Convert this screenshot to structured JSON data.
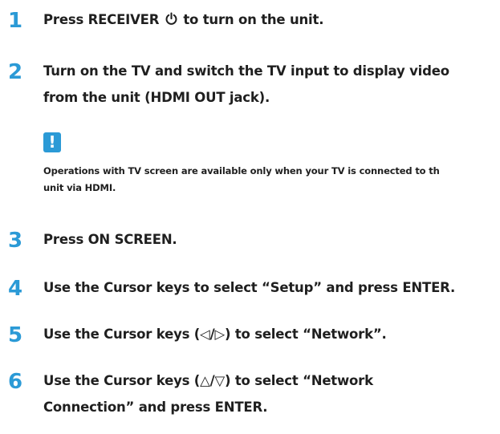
{
  "accent_color": "#2b9ad6",
  "steps": [
    {
      "num": "1",
      "pre": "Press RECEIVER ",
      "post": " to turn on the unit.",
      "icon": "power-icon"
    },
    {
      "num": "2",
      "line1": "Turn on the TV and switch the TV input to display video",
      "line2": "from the unit (HDMI OUT jack)."
    },
    {
      "num": "3",
      "line1": "Press ON SCREEN."
    },
    {
      "num": "4",
      "line1": "Use the Cursor keys to select “Setup” and press ENTER."
    },
    {
      "num": "5",
      "line1": "Use the Cursor keys (◁/▷) to select “Network”."
    },
    {
      "num": "6",
      "line1": "Use the Cursor keys (△/▽) to select “Network",
      "line2": "Connection” and press ENTER."
    }
  ],
  "note": {
    "icon": "!",
    "line1": "Operations with TV screen are available only when your TV is connected to th",
    "line2": "unit via HDMI."
  }
}
